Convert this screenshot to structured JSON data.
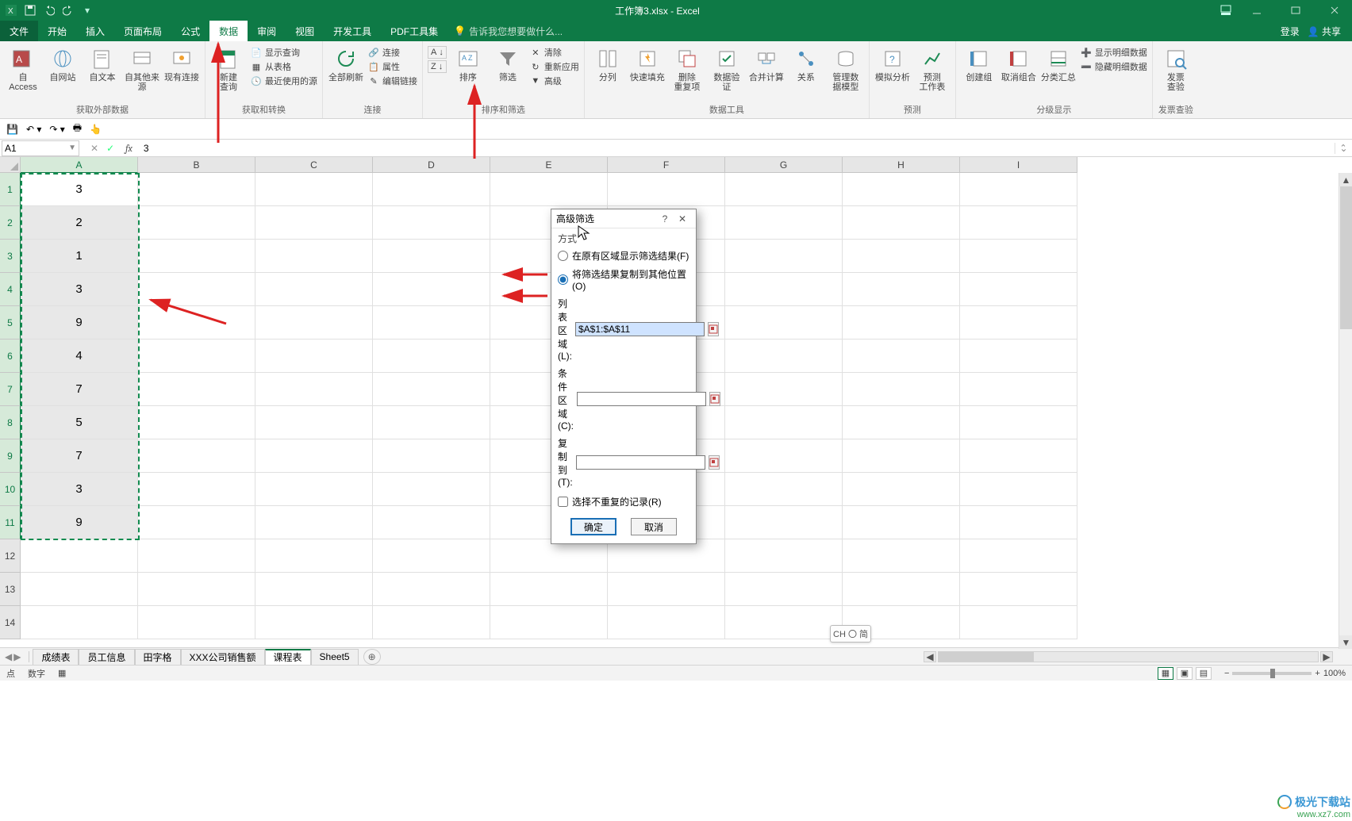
{
  "title": "工作簿3.xlsx - Excel",
  "tabs": {
    "file": "文件",
    "list": [
      "开始",
      "插入",
      "页面布局",
      "公式",
      "数据",
      "审阅",
      "视图",
      "开发工具",
      "PDF工具集"
    ],
    "active_index": 4,
    "tell_me": "告诉我您想要做什么...",
    "login": "登录",
    "share": "共享"
  },
  "ribbon": {
    "g_ext": {
      "label": "获取外部数据",
      "btns": [
        "自 Access",
        "自网站",
        "自文本",
        "自其他来源",
        "现有连接"
      ]
    },
    "g_get": {
      "label": "获取和转换",
      "newquery": "新建\n查询",
      "items": [
        "显示查询",
        "从表格",
        "最近使用的源"
      ]
    },
    "g_conn": {
      "label": "连接",
      "refresh": "全部刷新",
      "items": [
        "连接",
        "属性",
        "编辑链接"
      ]
    },
    "g_sort": {
      "label": "排序和筛选",
      "az": "A→Z",
      "za": "Z→A",
      "sort": "排序",
      "filter": "筛选",
      "items": [
        "清除",
        "重新应用",
        "高级"
      ]
    },
    "g_data": {
      "label": "数据工具",
      "btns": [
        "分列",
        "快速填充",
        "删除\n重复项",
        "数据验\n证",
        "合并计算",
        "关系",
        "管理数\n据模型"
      ]
    },
    "g_fc": {
      "label": "预测",
      "btns": [
        "模拟分析",
        "预测\n工作表"
      ]
    },
    "g_out": {
      "label": "分级显示",
      "btns": [
        "创建组",
        "取消组合",
        "分类汇总"
      ],
      "items": [
        "显示明细数据",
        "隐藏明细数据"
      ]
    },
    "g_inv": {
      "label": "发票查验",
      "btn": "发票\n查验"
    }
  },
  "namebox": "A1",
  "formula_value": "3",
  "columns": [
    "A",
    "B",
    "C",
    "D",
    "E",
    "F",
    "G",
    "H",
    "I"
  ],
  "rows": [
    "1",
    "2",
    "3",
    "4",
    "5",
    "6",
    "7",
    "8",
    "9",
    "10",
    "11",
    "12",
    "13",
    "14"
  ],
  "data_col_a": [
    "3",
    "2",
    "1",
    "3",
    "9",
    "4",
    "7",
    "5",
    "7",
    "3",
    "9"
  ],
  "dialog": {
    "title": "高级筛选",
    "method_label": "方式",
    "opt1": "在原有区域显示筛选结果(F)",
    "opt2": "将筛选结果复制到其他位置(O)",
    "list_range_label": "列表区域(L):",
    "list_range_value": "$A$1:$A$11",
    "criteria_label": "条件区域(C):",
    "criteria_value": "",
    "copyto_label": "复制到(T):",
    "copyto_value": "",
    "unique_label": "选择不重复的记录(R)",
    "ok": "确定",
    "cancel": "取消"
  },
  "sheets": [
    "成绩表",
    "员工信息",
    "田字格",
    "XXX公司销售额",
    "课程表",
    "Sheet5"
  ],
  "active_sheet_index": 4,
  "ime": "CH 〇 简",
  "status": {
    "mode": "点",
    "stat": "数字",
    "zoom": "100%"
  },
  "watermark": {
    "l1": "极光下载站",
    "l2": "www.xz7.com"
  }
}
